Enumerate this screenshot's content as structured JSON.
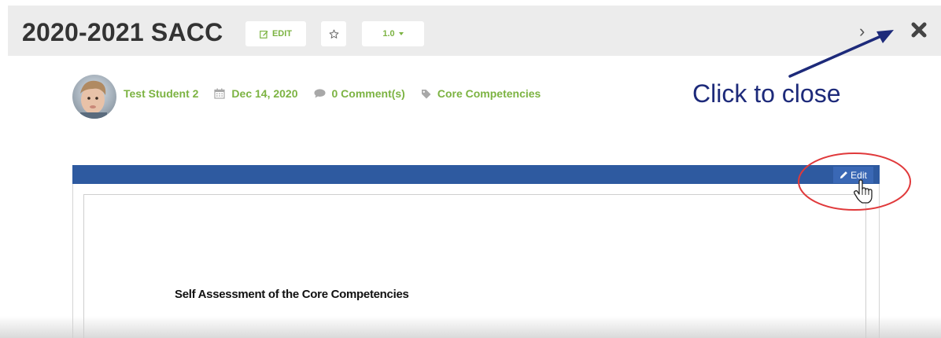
{
  "header": {
    "title": "2020-2021 SACC",
    "edit_label": "EDIT",
    "version_label": "1.0",
    "next_glyph": "›",
    "icons": [
      "edit-icon",
      "star-icon",
      "caret-down-icon",
      "chevron-right-icon",
      "close-icon"
    ]
  },
  "meta": {
    "author": "Test Student 2",
    "date": "Dec 14, 2020",
    "comments": "0 Comment(s)",
    "category": "Core Competencies",
    "icons": [
      "calendar-icon",
      "comment-icon",
      "tag-icon"
    ]
  },
  "annotation": {
    "text": "Click to close",
    "arrow_color": "#1d2a7a",
    "highlight_color": "#e0393b"
  },
  "document": {
    "edit_label": "Edit",
    "heading": "Self Assessment of the Core Competencies",
    "bar_color": "#2e5aa0"
  },
  "colors": {
    "accent_green": "#7cb342",
    "header_bg": "#ececec"
  }
}
